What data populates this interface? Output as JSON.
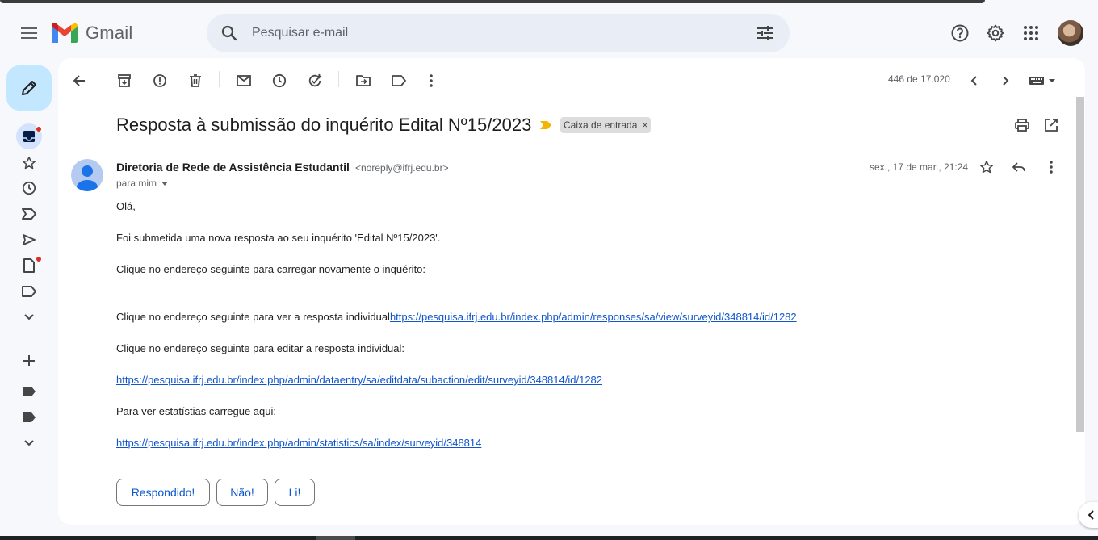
{
  "app": {
    "brand": "Gmail"
  },
  "search": {
    "placeholder": "Pesquisar e-mail"
  },
  "toolbar": {
    "count": "446 de 17.020"
  },
  "email": {
    "subject": "Resposta à submissão do inquérito Edital Nº15/2023",
    "label": "Caixa de entrada",
    "label_remove": "×",
    "sender_name": "Diretoria de Rede de Assistência Estudantil",
    "sender_email": "<noreply@ifrj.edu.br>",
    "recipient": "para mim",
    "date": "sex., 17 de mar., 21:24",
    "body": {
      "greeting": "Olá,",
      "p1": "Foi submetida uma nova resposta ao seu inquérito 'Edital Nº15/2023'.",
      "p2": "Clique no endereço seguinte para carregar novamente o inquérito:",
      "p3_text": "Clique no endereço seguinte para ver a resposta individual",
      "p3_link": "https://pesquisa.ifrj.edu.br/index.php/admin/responses/sa/view/surveyid/348814/id/1282",
      "p4": "Clique no endereço seguinte para editar a resposta individual:",
      "p5_link": "https://pesquisa.ifrj.edu.br/index.php/admin/dataentry/sa/editdata/subaction/edit/surveyid/348814/id/1282",
      "p6": "Para ver estatístias carregue aqui:",
      "p7_link": "https://pesquisa.ifrj.edu.br/index.php/admin/statistics/sa/index/surveyid/348814"
    },
    "smart_replies": [
      "Respondido!",
      "Não!",
      "Li!"
    ]
  },
  "colors": {
    "background": "#f6f8fc",
    "compose": "#c2e7ff",
    "link": "#1155cc",
    "accent": "#0b57d0",
    "notification": "#d93025",
    "important": "#f4b400"
  },
  "icons": {
    "header": [
      "menu-icon",
      "gmail-logo-icon",
      "search-icon",
      "search-options-icon",
      "help-icon",
      "settings-icon",
      "apps-icon"
    ],
    "rail": [
      "compose-icon",
      "inbox-icon",
      "starred-icon",
      "snoozed-icon",
      "important-icon",
      "sent-icon",
      "drafts-icon",
      "label-icon",
      "more-icon",
      "add-label-icon",
      "label-icon",
      "label-icon",
      "more-icon"
    ],
    "toolbar": [
      "back-icon",
      "archive-icon",
      "report-spam-icon",
      "delete-icon",
      "mark-unread-icon",
      "snooze-icon",
      "add-task-icon",
      "move-to-icon",
      "labels-icon",
      "more-vert-icon",
      "prev-icon",
      "next-icon",
      "keyboard-icon"
    ]
  }
}
